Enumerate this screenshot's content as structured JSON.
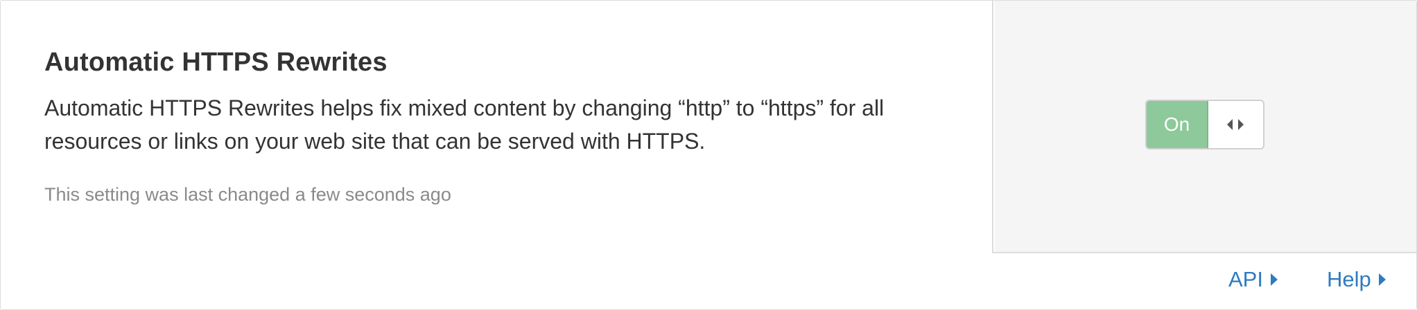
{
  "setting": {
    "title": "Automatic HTTPS Rewrites",
    "description": "Automatic HTTPS Rewrites helps fix mixed content by changing “http” to “https” for all resources or links on your web site that can be served with HTTPS.",
    "last_changed": "This setting was last changed a few seconds ago"
  },
  "toggle": {
    "state": "on",
    "on_label": "On",
    "handle_icon": "left-right-arrows-icon",
    "on_color": "#8dc99a"
  },
  "footer": {
    "links": [
      {
        "label": "API",
        "icon": "caret-right-icon"
      },
      {
        "label": "Help",
        "icon": "caret-right-icon"
      }
    ],
    "link_color": "#2f7bbf"
  }
}
